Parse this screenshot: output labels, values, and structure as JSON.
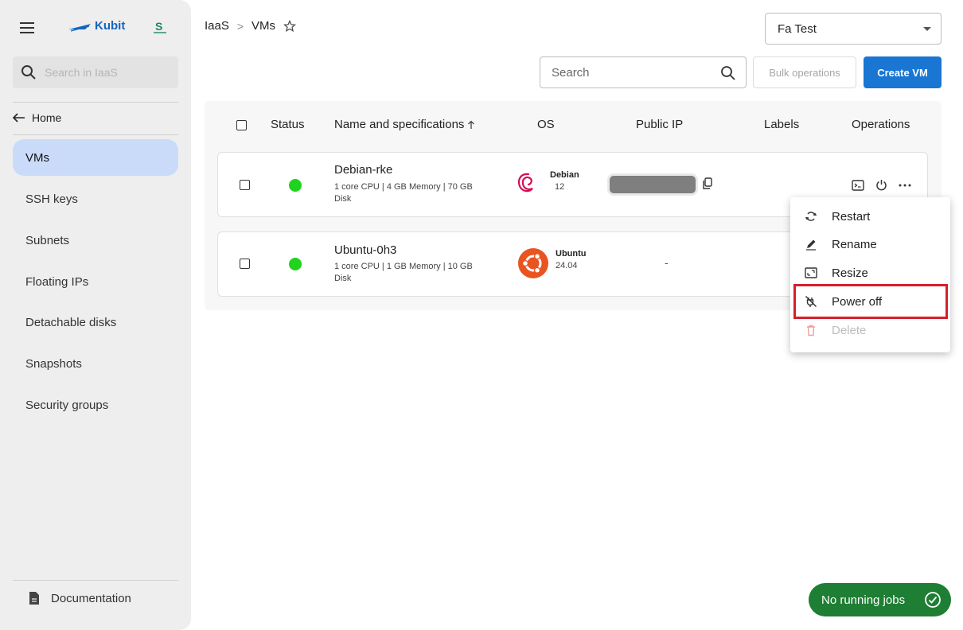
{
  "sidebar": {
    "logo_text": "Kubit",
    "search_placeholder": "Search in IaaS",
    "home_label": "Home",
    "items": [
      {
        "label": "VMs",
        "active": true
      },
      {
        "label": "SSH keys"
      },
      {
        "label": "Subnets"
      },
      {
        "label": "Floating IPs"
      },
      {
        "label": "Detachable disks"
      },
      {
        "label": "Snapshots"
      },
      {
        "label": "Security groups"
      }
    ],
    "documentation_label": "Documentation"
  },
  "breadcrumb": {
    "root": "IaaS",
    "current": "VMs"
  },
  "project_select": {
    "value": "Fa Test"
  },
  "toolbar": {
    "search_placeholder": "Search",
    "bulk_label": "Bulk operations",
    "create_label": "Create VM"
  },
  "table": {
    "headers": {
      "status": "Status",
      "name": "Name and specifications",
      "os": "OS",
      "public_ip": "Public IP",
      "labels": "Labels",
      "operations": "Operations"
    },
    "rows": [
      {
        "name": "Debian-rke",
        "spec_line1": "1 core CPU | 4 GB Memory | 70 GB",
        "spec_line2": "Disk",
        "os_name": "Debian",
        "os_version": "12",
        "status_color": "#1fd31f"
      },
      {
        "name": "Ubuntu-0h3",
        "spec_line1": "1 core CPU | 1 GB Memory | 10 GB",
        "spec_line2": "Disk",
        "os_name": "Ubuntu",
        "os_version": "24.04",
        "public_ip": "-",
        "status_color": "#1fd31f"
      }
    ]
  },
  "menu": {
    "items": [
      {
        "label": "Restart",
        "icon": "restart-icon"
      },
      {
        "label": "Rename",
        "icon": "pencil-icon"
      },
      {
        "label": "Resize",
        "icon": "resize-icon"
      },
      {
        "label": "Power off",
        "icon": "power-off-icon",
        "highlighted": true
      },
      {
        "label": "Delete",
        "icon": "trash-icon",
        "disabled": true
      }
    ]
  },
  "jobs": {
    "label": "No running jobs"
  },
  "colors": {
    "accent": "#1976d2",
    "active_nav": "#c9dbf8",
    "status_ok": "#1fd31f",
    "jobs_pill": "#1e7e34",
    "highlight": "#d3212c"
  }
}
